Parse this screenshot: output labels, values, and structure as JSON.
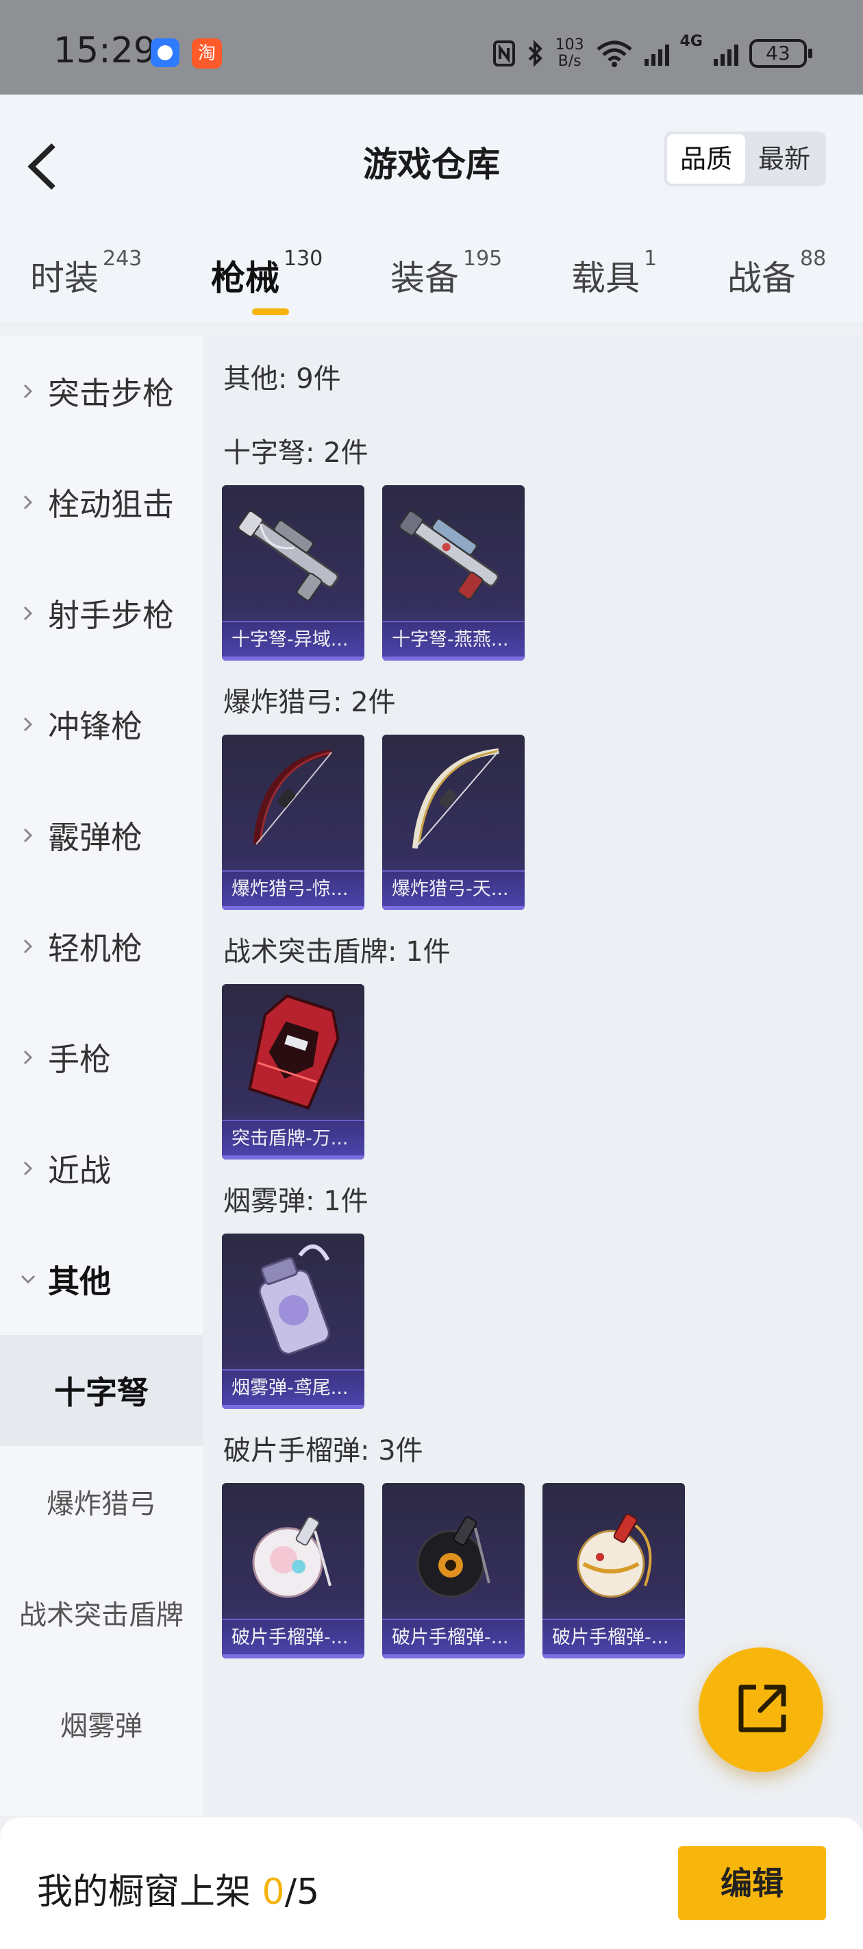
{
  "status_bar": {
    "time": "15:29",
    "app_badge": "淘",
    "net_speed_value": "103",
    "net_speed_unit": "B/s",
    "net_type": "4G",
    "battery": "43"
  },
  "header": {
    "title": "游戏仓库",
    "sort_options": [
      "品质",
      "最新"
    ],
    "sort_active": "品质"
  },
  "tabs": [
    {
      "label": "时装",
      "count": "243"
    },
    {
      "label": "枪械",
      "count": "130"
    },
    {
      "label": "装备",
      "count": "195"
    },
    {
      "label": "载具",
      "count": "1"
    },
    {
      "label": "战备",
      "count": "88"
    }
  ],
  "active_tab": "枪械",
  "sidebar": {
    "categories": [
      "突击步枪",
      "栓动狙击",
      "射手步枪",
      "冲锋枪",
      "霰弹枪",
      "轻机枪",
      "手枪",
      "近战",
      "其他"
    ],
    "open_category": "其他",
    "subcategories": [
      "十字弩",
      "爆炸猎弓",
      "战术突击盾牌",
      "烟雾弹"
    ],
    "active_subcategory": "十字弩"
  },
  "content": {
    "summary": "其他: 9件",
    "groups": [
      {
        "title": "十字弩: 2件",
        "items": [
          "十字弩-异域...",
          "十字弩-燕燕..."
        ]
      },
      {
        "title": "爆炸猎弓: 2件",
        "items": [
          "爆炸猎弓-惊...",
          "爆炸猎弓-天..."
        ]
      },
      {
        "title": "战术突击盾牌: 1件",
        "items": [
          "突击盾牌-万..."
        ]
      },
      {
        "title": "烟雾弹: 1件",
        "items": [
          "烟雾弹-鸢尾..."
        ]
      },
      {
        "title": "破片手榴弹: 3件",
        "items": [
          "破片手榴弹-...",
          "破片手榴弹-...",
          "破片手榴弹-..."
        ]
      }
    ]
  },
  "bottom_bar": {
    "label": "我的橱窗上架 ",
    "current": "0",
    "total": "/5",
    "edit_label": "编辑"
  },
  "colors": {
    "accent": "#f8b60d",
    "card_bg": "#352f5e",
    "card_caption": "#4d45b0"
  },
  "icons": {
    "back": "chevron-left-icon",
    "collapsed": "chevron-right-icon",
    "expanded": "chevron-down-icon",
    "fab": "share-external-icon"
  }
}
